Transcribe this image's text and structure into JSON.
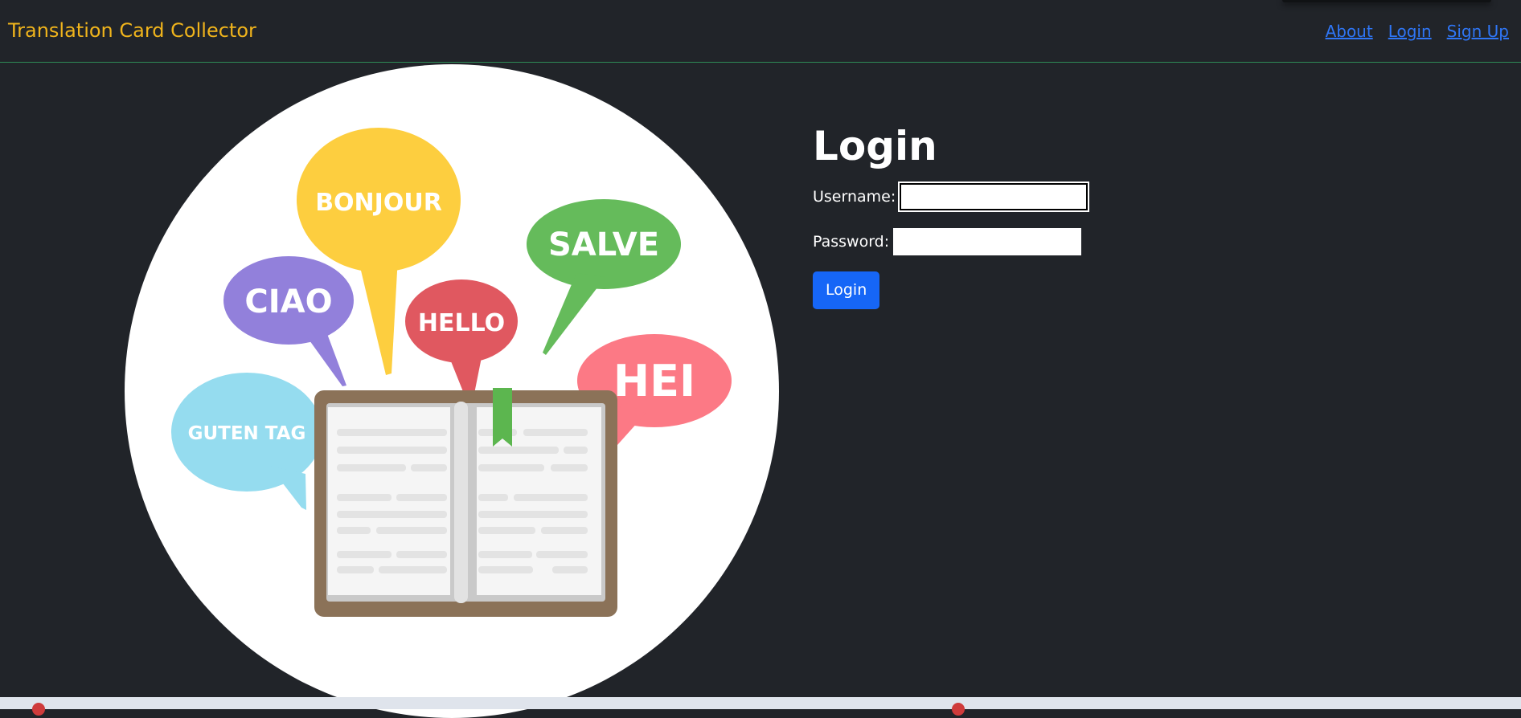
{
  "navbar": {
    "brand": "Translation Card Collector",
    "links": [
      {
        "label": "About"
      },
      {
        "label": "Login"
      },
      {
        "label": "Sign Up"
      }
    ]
  },
  "hero": {
    "bubbles": {
      "bonjour": "BONJOUR",
      "salve": "SALVE",
      "ciao": "CIAO",
      "hello": "HELLO",
      "hei": "HEI",
      "guten_tag": "GUTEN TAG"
    }
  },
  "login": {
    "title": "Login",
    "username_label": "Username:",
    "username_value": "",
    "password_label": "Password:",
    "password_value": "",
    "submit_label": "Login"
  },
  "colors": {
    "background": "#212429",
    "brand": "#f0b41c",
    "link": "#2f76f5",
    "button": "#1666f7"
  }
}
